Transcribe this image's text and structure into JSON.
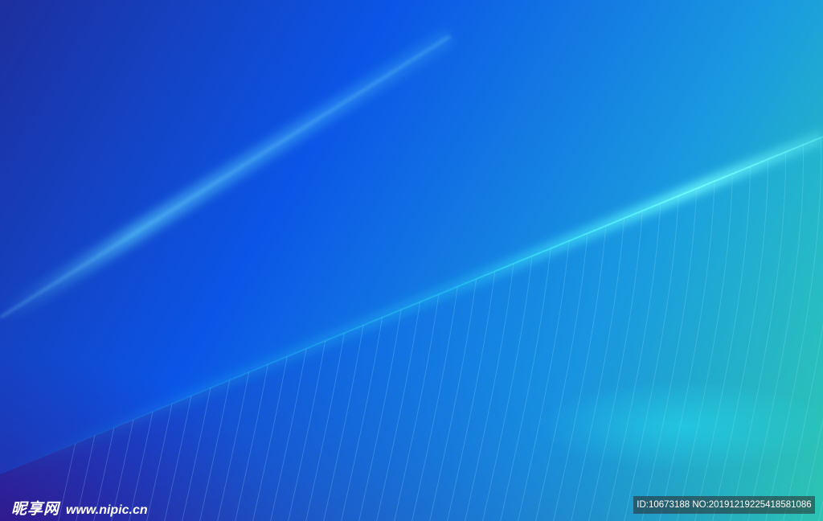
{
  "watermark": {
    "logo_text": "昵享网",
    "site_url": "www.nipic.cn",
    "id_text": "ID:10673188 NO:20191219225418581086"
  },
  "colors": {
    "deep_blue": "#1d2f9e",
    "mid_blue": "#0b55e6",
    "cyan": "#1a9bdf",
    "teal": "#33d6a8",
    "glow": "#3df0f0"
  }
}
